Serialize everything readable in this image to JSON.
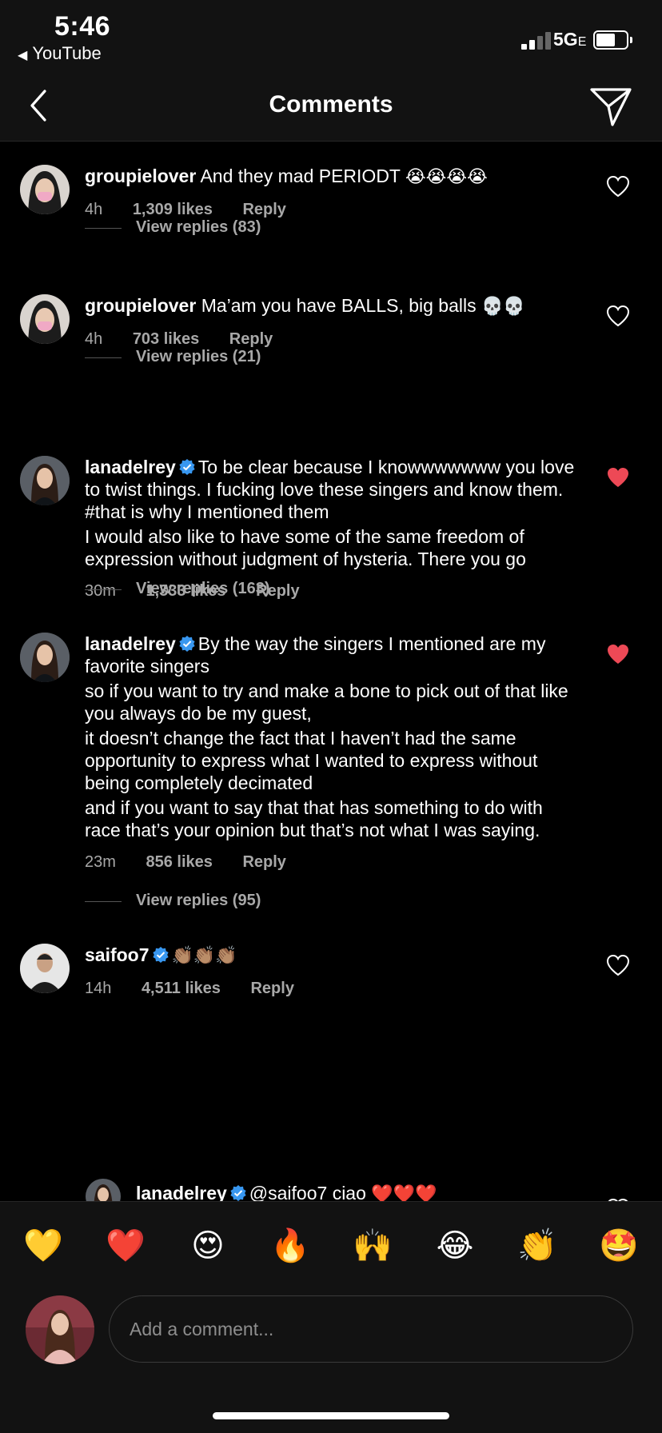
{
  "status": {
    "time": "5:46",
    "back_app": "YouTube",
    "network": "5G",
    "network_suffix": "E"
  },
  "header": {
    "title": "Comments"
  },
  "comments": [
    {
      "user": "groupielover",
      "verified": false,
      "paragraphs": [
        "And they mad PERIODT"
      ],
      "emojis": "😭😭😭😭",
      "age": "4h",
      "likes": "1,309 likes",
      "reply": "Reply",
      "liked": false,
      "view_replies": "View replies (83)"
    },
    {
      "user": "groupielover",
      "verified": false,
      "paragraphs": [
        "Ma’am you have BALLS, big balls"
      ],
      "emojis": "💀💀",
      "age": "4h",
      "likes": "703 likes",
      "reply": "Reply",
      "liked": false,
      "view_replies": "View replies (21)"
    },
    {
      "user": "lanadelrey",
      "verified": true,
      "paragraphs": [
        "To be clear because I knowwwwwww you love to twist things. I fucking love these singers and know them. #that is why I mentioned them",
        "I would also like to have some of the same freedom of expression without judgment of hysteria. There you go"
      ],
      "age": "30m",
      "likes": "1,333 likes",
      "reply": "Reply",
      "liked": true,
      "view_replies": "View replies (163)"
    },
    {
      "user": "lanadelrey",
      "verified": true,
      "paragraphs": [
        "By the way the singers I mentioned are my favorite singers",
        "so if you want to try and make a bone to pick out of that like you always do be my guest,",
        "it doesn’t change the fact that I haven’t had the same opportunity to express what I wanted to express without being completely decimated",
        "and if you want to say that that has something to do with race that’s your opinion but that’s not what I was saying."
      ],
      "age": "23m",
      "likes": "856 likes",
      "reply": "Reply",
      "liked": true,
      "view_replies": "View replies (95)"
    },
    {
      "user": "saifoo7",
      "verified": true,
      "paragraphs": [],
      "emojis": "👏🏽👏🏽👏🏽",
      "age": "14h",
      "likes": "4,511 likes",
      "reply": "Reply",
      "liked": false
    }
  ],
  "reply_preview": {
    "user": "lanadelrey",
    "verified": true,
    "text": "@saifoo7 ciao",
    "emojis": "❤️❤️❤️"
  },
  "emoji_bar": [
    "💛",
    "❤️",
    "😍",
    "🔥",
    "🙌",
    "😂",
    "👏",
    "🤩"
  ],
  "composer": {
    "placeholder": "Add a comment..."
  },
  "colors": {
    "background": "#000000",
    "bar": "#121212",
    "muted": "#a8a8a8",
    "like_red": "#ed4956",
    "verified_blue": "#3897f0"
  },
  "icons": [
    "back-chevron-icon",
    "send-icon",
    "heart-icon",
    "verified-badge-icon"
  ]
}
